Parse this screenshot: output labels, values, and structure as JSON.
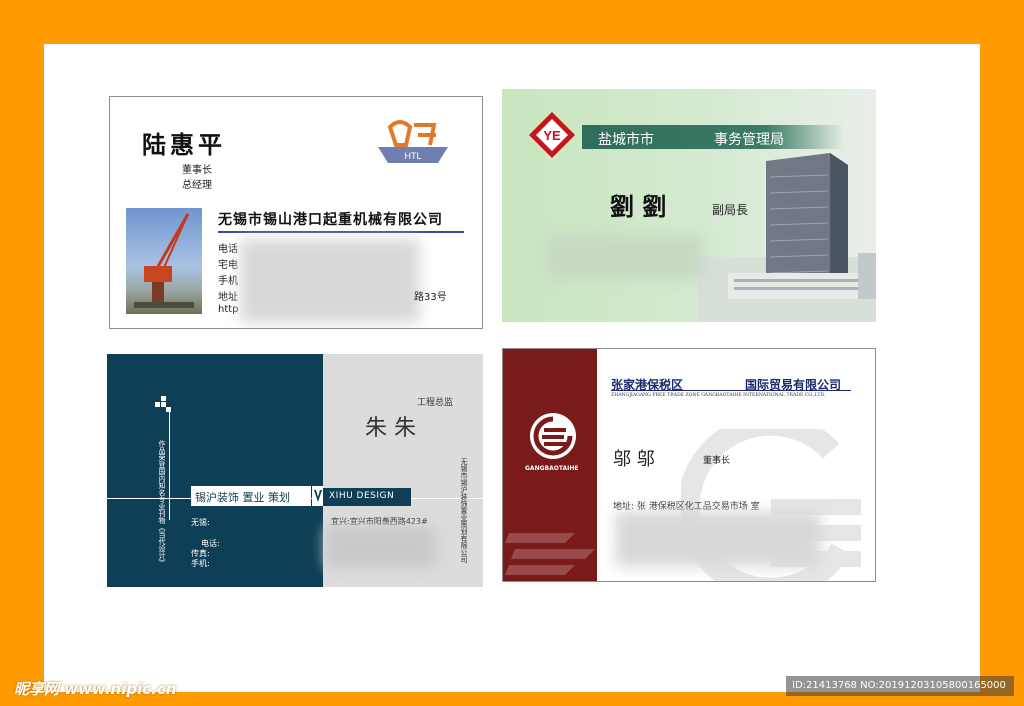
{
  "card1": {
    "name": "陆惠平",
    "title1": "董事长",
    "title2": "总经理",
    "company": "无锡市锡山港口起重机械有限公司",
    "rows": [
      "电话",
      "宅电",
      "手机",
      "地址",
      "http"
    ],
    "address_tail": "路33号",
    "logo_text": "HTL"
  },
  "card2": {
    "banner_left": "盐城市市",
    "banner_right": "事务管理局",
    "name": "劉  劉",
    "title": "副局長"
  },
  "card3": {
    "title": "工程总监",
    "name": "朱  朱",
    "slogan": "锡沪装饰 置业 策划",
    "brand": "XIHU DESIGN",
    "address": "宜兴:宜兴市阳羡西路423#",
    "rows": [
      "无锡:",
      "电话:",
      "传真:",
      "手机:"
    ],
    "vertical_left": "作品荣登国内知名专业刊物《当代设计》",
    "vertical_right": "无锡市锡沪装饰置业策划有限公司"
  },
  "card4": {
    "company_cn_left": "张家港保税区",
    "company_cn_right": "国际贸易有限公司",
    "company_en": "ZHANGJIAGANG FREE TRADE ZONE GANGBAOTAIHE INTERNATIONAL TRADE CO.,LTD.",
    "name": "邬  邬",
    "title": "董事长",
    "address": "地址: 张   港保税区化工品交易市场     室",
    "logo_text": "GANGBAOTAIHE"
  },
  "footer": {
    "watermark": "昵享网 www.nipic.cn",
    "id_text": "ID:21413768 NO:20191203105800165000"
  },
  "colors": {
    "frame": "#ff9a00",
    "card3_teal": "#0e3f56",
    "card4_maroon": "#7a1a1a",
    "card2_banner": "#2f6e5c",
    "logo_red": "#c8141c"
  }
}
